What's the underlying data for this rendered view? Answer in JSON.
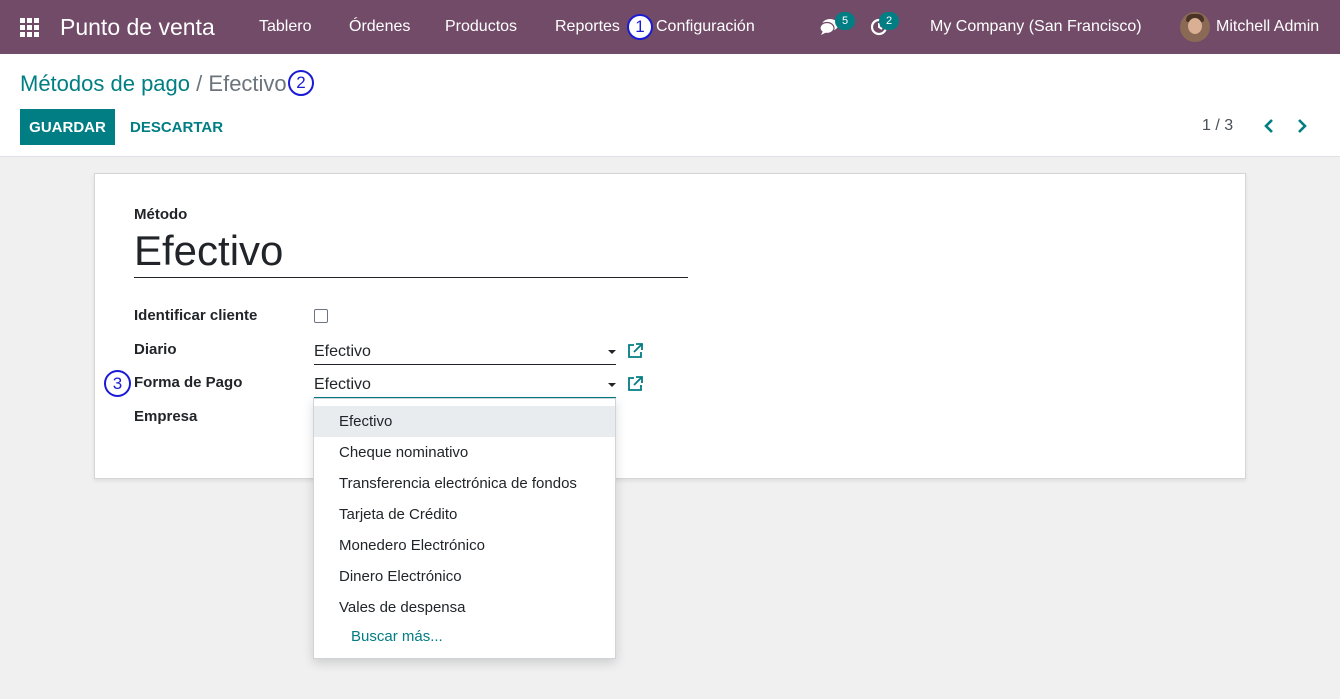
{
  "navbar": {
    "app_title": "Punto de venta",
    "menu": [
      "Tablero",
      "Órdenes",
      "Productos",
      "Reportes",
      "Configuración"
    ],
    "chat_badge": "5",
    "activity_badge": "2",
    "company": "My Company (San Francisco)",
    "user": "Mitchell Admin"
  },
  "callouts": [
    "1",
    "2",
    "3"
  ],
  "breadcrumb": {
    "parent": "Métodos de pago",
    "separator": "/",
    "current": "Efectivo"
  },
  "buttons": {
    "save": "GUARDAR",
    "discard": "DESCARTAR"
  },
  "pager": {
    "value": "1 / 3"
  },
  "form": {
    "name_label": "Método",
    "name_value": "Efectivo",
    "fields": [
      {
        "label": "Identificar cliente",
        "type": "checkbox",
        "checked": false
      },
      {
        "label": "Diario",
        "type": "many2one",
        "value": "Efectivo"
      },
      {
        "label": "Forma de Pago",
        "type": "many2one",
        "value": "Efectivo"
      },
      {
        "label": "Empresa",
        "type": "many2one",
        "value": ""
      }
    ]
  },
  "dropdown": {
    "options": [
      "Efectivo",
      "Cheque nominativo",
      "Transferencia electrónica de fondos",
      "Tarjeta de Crédito",
      "Monedero Electrónico",
      "Dinero Electrónico",
      "Vales de despensa"
    ],
    "highlighted": "Efectivo",
    "search_more": "Buscar más..."
  },
  "colors": {
    "navbar": "#714b67",
    "primary": "#017e84",
    "callout": "#1b1bd6"
  },
  "icons": [
    "apps-grid-icon",
    "chat-icon",
    "activity-clock-icon",
    "chevron-left-icon",
    "chevron-right-icon",
    "external-link-icon",
    "dropdown-caret-icon"
  ]
}
